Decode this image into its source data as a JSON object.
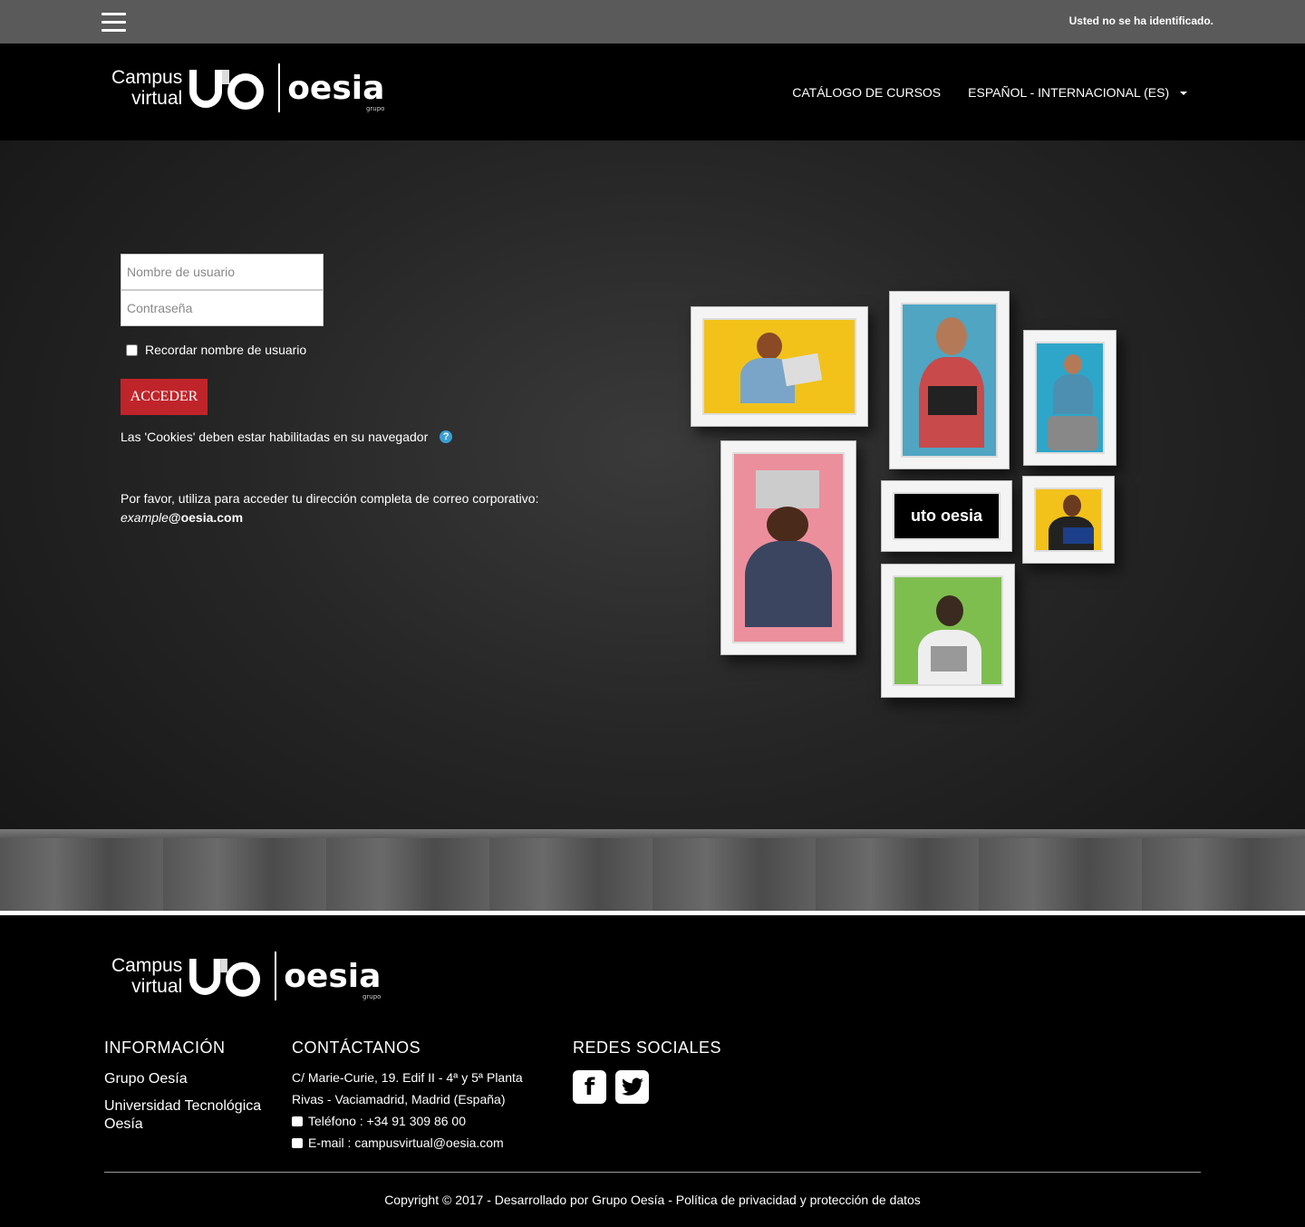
{
  "topbar": {
    "status": "Usted no se ha identificado."
  },
  "header": {
    "logo": {
      "campus": "Campus",
      "virtual": "virtual",
      "mark": "uto",
      "brand": "oesia",
      "brand_sub": "grupo"
    },
    "nav": {
      "catalog": "CATÁLOGO DE CURSOS",
      "language": "ESPAÑOL - INTERNACIONAL (ES)"
    }
  },
  "login": {
    "username_placeholder": "Nombre de usuario",
    "password_placeholder": "Contraseña",
    "remember_label": "Recordar nombre de usuario",
    "submit_label": "ACCEDER",
    "cookies_text": "Las 'Cookies' deben estar habilitadas en su navegador",
    "notice_text": "Por favor, utiliza para acceder tu dirección completa de correo corporativo:",
    "notice_example": "example",
    "notice_domain": "@oesia.com"
  },
  "footer": {
    "logo": {
      "campus": "Campus",
      "virtual": "virtual",
      "mark": "uto",
      "brand": "oesia",
      "brand_sub": "grupo"
    },
    "info": {
      "title": "INFORMACIÓN",
      "links": [
        "Grupo Oesía",
        "Universidad Tecnológica Oesía"
      ]
    },
    "contact": {
      "title": "CONTÁCTANOS",
      "address1": "C/ Marie-Curie, 19. Edif II - 4ª y 5ª Planta",
      "address2": "Rivas - Vaciamadrid, Madrid (España)",
      "phone": "Teléfono : +34 91 309 86 00",
      "email": "E-mail : campusvirtual@oesia.com"
    },
    "social": {
      "title": "REDES SOCIALES",
      "icons": [
        "facebook-icon",
        "twitter-icon"
      ]
    },
    "copyright": "Copyright © 2017 - Desarrollado por Grupo Oesía - Política de privacidad y protección de datos"
  },
  "colors": {
    "accent": "#c0242b",
    "topbar": "#5a5a5a",
    "help": "#3a9fd6"
  }
}
